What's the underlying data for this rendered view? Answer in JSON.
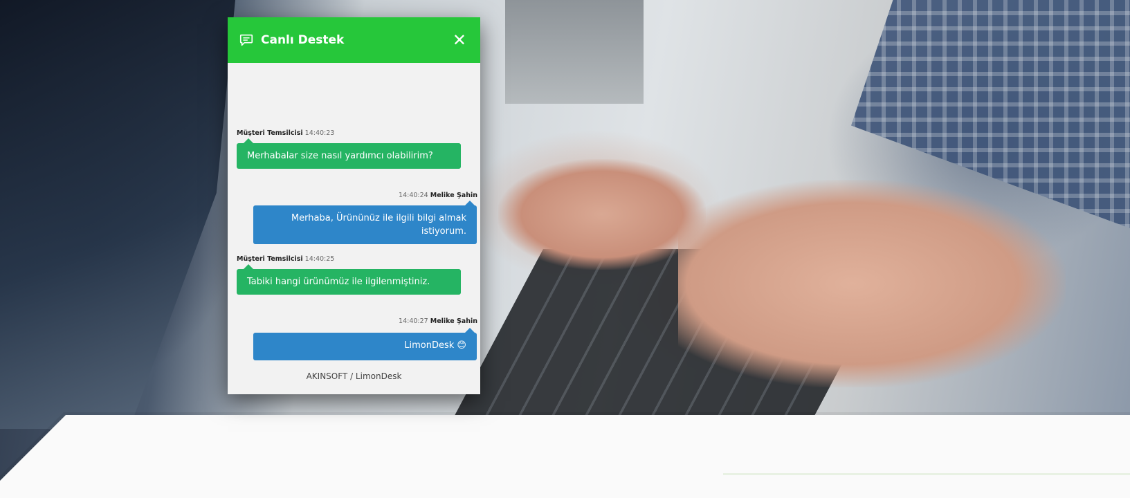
{
  "chat": {
    "title": "Canlı Destek",
    "close_label": "✕",
    "footer": "AKINSOFT / LimonDesk",
    "messages": [
      {
        "sender": "Müşteri Temsilcisi",
        "time": "14:40:23",
        "text": "Merhabalar size nasıl yardımcı olabilirim?"
      },
      {
        "sender": "Melike Şahin",
        "time": "14:40:24",
        "text": "Merhaba, Ürününüz ile ilgili bilgi almak istiyorum."
      },
      {
        "sender": "Müşteri Temsilcisi",
        "time": "14:40:25",
        "text": "Tabiki hangi ürünümüz ile ilgilenmiştiniz."
      },
      {
        "sender": "Melike Şahin",
        "time": "14:40:27",
        "text": "LimonDesk 😊"
      }
    ]
  },
  "colors": {
    "header": "#26c73a",
    "agent_bubble": "#25b463",
    "user_bubble": "#2e86c9"
  },
  "icons": {
    "header_icon": "chat-bubble-icon",
    "close_icon": "close-icon"
  }
}
